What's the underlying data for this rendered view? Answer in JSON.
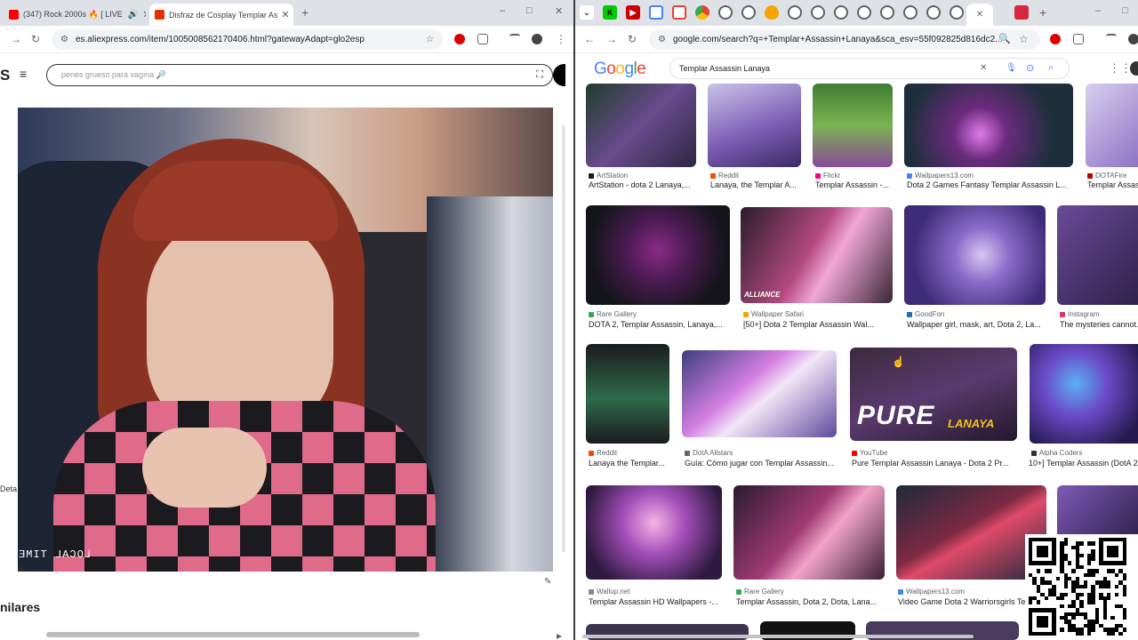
{
  "left_window": {
    "tabs": [
      {
        "title": "(347) Rock 2000s 🔥 [ LIVE",
        "active": false,
        "favicon_color": "#ff0000"
      },
      {
        "title": "Disfraz de Cosplay Templar As",
        "active": true,
        "favicon_color": "#e62e04"
      }
    ],
    "new_tab": "+",
    "window_controls": [
      "–",
      "□",
      "✕"
    ],
    "url": "es.aliexpress.com/item/1005008562170406.html?gatewayAdapt=glo2esp",
    "search_placeholder": "penes grueso para vagina 🔎",
    "logo_fragment": "S",
    "stream_overlay_text": "LOCAL TIME",
    "side_label": "Deta",
    "similar_heading": "nilares"
  },
  "right_window": {
    "url": "google.com/search?q=+Templar+Assassin+Lanaya&sca_esv=55f092825d816dc2...",
    "query": "Templar Assassin Lanaya",
    "logo": "Google",
    "logo_colors": [
      "#4285f4",
      "#ea4335",
      "#fbbc05",
      "#4285f4",
      "#34a853",
      "#ea4335"
    ],
    "tab_icons": [
      "chevron-down",
      "keep",
      "youtube",
      "google",
      "google",
      "chrome",
      "globe",
      "globe",
      "flame",
      "globe",
      "globe",
      "globe",
      "globe",
      "globe",
      "globe",
      "globe",
      "active",
      "red"
    ],
    "results": [
      {
        "source": "ArtStation",
        "title": "ArtStation - dota 2 Lanaya,...",
        "source_color": "#1a1a1a"
      },
      {
        "source": "Reddit",
        "title": "Lanaya, the Templar A...",
        "source_color": "#ff4500"
      },
      {
        "source": "Flickr",
        "title": "Templar Assassin -...",
        "source_color": "#ff0084"
      },
      {
        "source": "Wallpapers13.com",
        "title": "Dota 2 Games Fantasy Templar Assassin L...",
        "source_color": "#4285f4"
      },
      {
        "source": "DOTAFire",
        "title": "Templar Assas...",
        "source_color": "#b00"
      },
      {
        "source": "Rare Gallery",
        "title": "DOTA 2, Templar Assassin, Lanaya,...",
        "source_color": "#34a853"
      },
      {
        "source": "Wallpaper Safari",
        "title": "[50+] Dota 2 Templar Assassin Wal...",
        "source_color": "#f4a300"
      },
      {
        "source": "GoodFon",
        "title": "Wallpaper girl, mask, art, Dota 2, La...",
        "source_color": "#1a6fb5"
      },
      {
        "source": "Instagram",
        "title": "The mysteries cannot...",
        "source_color": "#e1306c"
      },
      {
        "source": "Reddit",
        "title": "Lanaya the Templar...",
        "source_color": "#ff4500"
      },
      {
        "source": "DotA Allstars",
        "title": "Guía: Cómo jugar con Templar Assassin...",
        "source_color": "#666"
      },
      {
        "source": "YouTube",
        "title": "Pure Templar Assassin Lanaya - Dota 2 Pr...",
        "source_color": "#ff0000"
      },
      {
        "source": "Alpha Coders",
        "title": "10+] Templar Assassin (DotA 2...",
        "source_color": "#333"
      },
      {
        "source": "Wallup.net",
        "title": "Templar Assassin HD Wallpapers -...",
        "source_color": "#888"
      },
      {
        "source": "Rare Gallery",
        "title": "Templar Assassin, Dota 2, Dota, Lana...",
        "source_color": "#34a853"
      },
      {
        "source": "Wallpapers13.com",
        "title": "Video Game Dota 2 Warriorsgirls Te...",
        "source_color": "#4285f4"
      }
    ],
    "image_caption_pure": "PURE",
    "image_caption_lanaya": "LANAYA",
    "image_caption_alliance": "ALLIANCE"
  }
}
